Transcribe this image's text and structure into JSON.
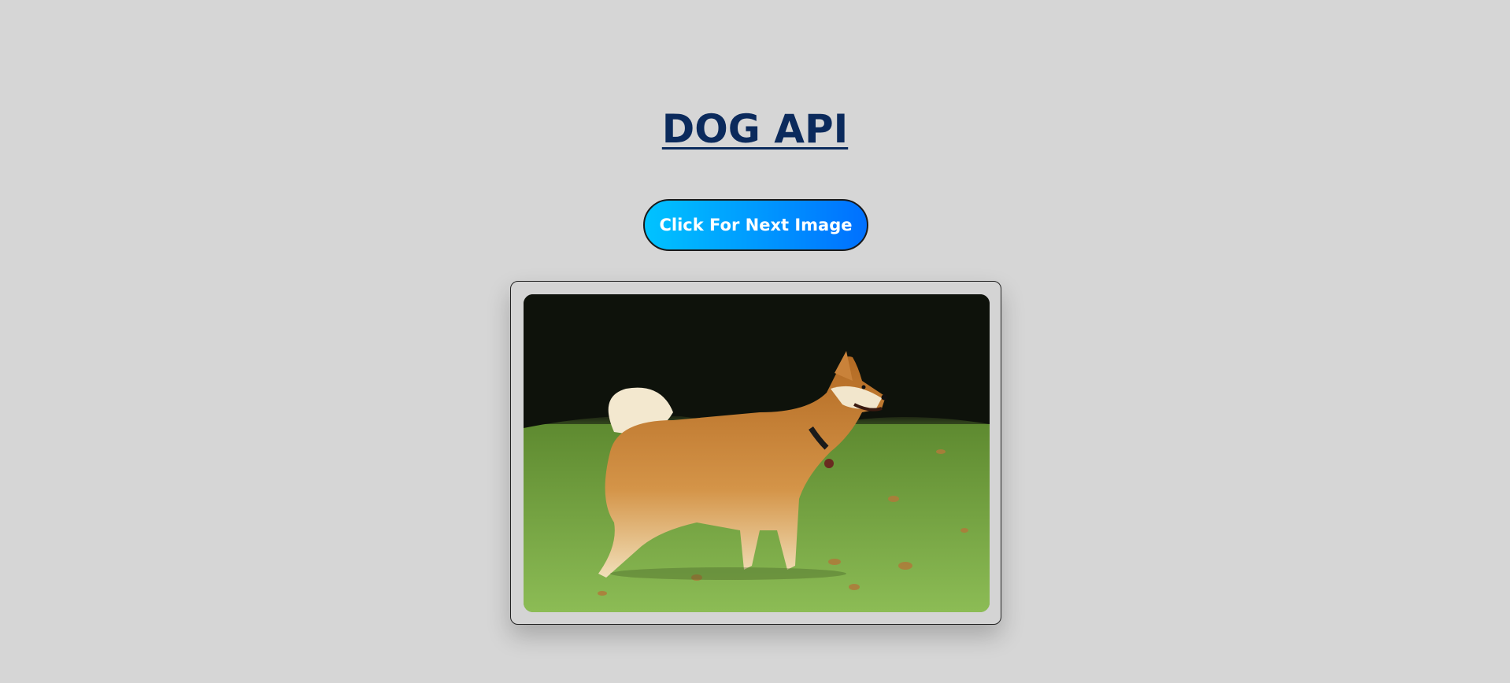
{
  "header": {
    "title": "DOG API"
  },
  "controls": {
    "next_label": "Click For Next Image"
  },
  "image": {
    "subject": "dog-photo"
  },
  "colors": {
    "background": "#d6d6d6",
    "title": "#0b2a5c",
    "button_gradient_start": "#00c3ff",
    "button_gradient_end": "#0070ff"
  }
}
